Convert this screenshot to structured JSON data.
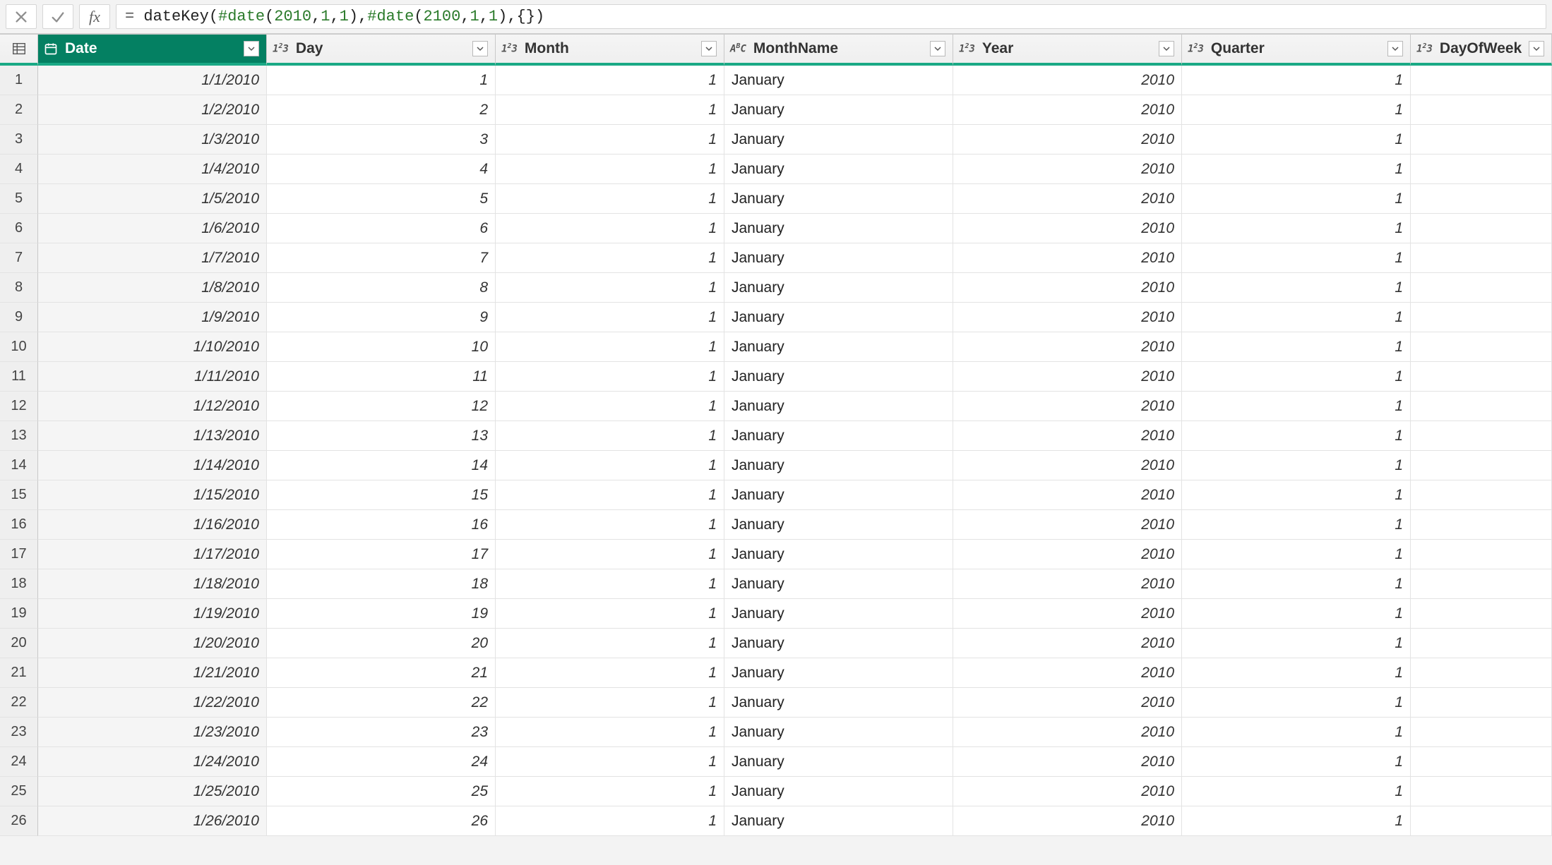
{
  "formula": {
    "raw": "= dateKey(#date(2010,1,1),#date(2100,1,1),{})",
    "tokens": [
      {
        "t": "eq",
        "v": "= "
      },
      {
        "t": "fn",
        "v": "dateKey"
      },
      {
        "t": "p",
        "v": "("
      },
      {
        "t": "kw",
        "v": "#date"
      },
      {
        "t": "p",
        "v": "("
      },
      {
        "t": "num",
        "v": "2010"
      },
      {
        "t": "c",
        "v": ","
      },
      {
        "t": "num",
        "v": "1"
      },
      {
        "t": "c",
        "v": ","
      },
      {
        "t": "num",
        "v": "1"
      },
      {
        "t": "p",
        "v": ")"
      },
      {
        "t": "c",
        "v": ","
      },
      {
        "t": "kw",
        "v": "#date"
      },
      {
        "t": "p",
        "v": "("
      },
      {
        "t": "num",
        "v": "2100"
      },
      {
        "t": "c",
        "v": ","
      },
      {
        "t": "num",
        "v": "1"
      },
      {
        "t": "c",
        "v": ","
      },
      {
        "t": "num",
        "v": "1"
      },
      {
        "t": "p",
        "v": ")"
      },
      {
        "t": "c",
        "v": ","
      },
      {
        "t": "p",
        "v": "{"
      },
      {
        "t": "p",
        "v": "}"
      },
      {
        "t": "p",
        "v": ")"
      }
    ]
  },
  "columns": [
    {
      "name": "Date",
      "type": "date",
      "align": "num",
      "selected": true
    },
    {
      "name": "Day",
      "type": "number",
      "align": "num",
      "selected": false
    },
    {
      "name": "Month",
      "type": "number",
      "align": "num",
      "selected": false
    },
    {
      "name": "MonthName",
      "type": "text",
      "align": "text",
      "selected": false
    },
    {
      "name": "Year",
      "type": "number",
      "align": "num",
      "selected": false
    },
    {
      "name": "Quarter",
      "type": "number",
      "align": "num",
      "selected": false
    },
    {
      "name": "DayOfWeek",
      "type": "number",
      "align": "num",
      "selected": false
    }
  ],
  "rows": [
    {
      "n": 1,
      "Date": "1/1/2010",
      "Day": "1",
      "Month": "1",
      "MonthName": "January",
      "Year": "2010",
      "Quarter": "1",
      "DayOfWeek": ""
    },
    {
      "n": 2,
      "Date": "1/2/2010",
      "Day": "2",
      "Month": "1",
      "MonthName": "January",
      "Year": "2010",
      "Quarter": "1",
      "DayOfWeek": ""
    },
    {
      "n": 3,
      "Date": "1/3/2010",
      "Day": "3",
      "Month": "1",
      "MonthName": "January",
      "Year": "2010",
      "Quarter": "1",
      "DayOfWeek": ""
    },
    {
      "n": 4,
      "Date": "1/4/2010",
      "Day": "4",
      "Month": "1",
      "MonthName": "January",
      "Year": "2010",
      "Quarter": "1",
      "DayOfWeek": ""
    },
    {
      "n": 5,
      "Date": "1/5/2010",
      "Day": "5",
      "Month": "1",
      "MonthName": "January",
      "Year": "2010",
      "Quarter": "1",
      "DayOfWeek": ""
    },
    {
      "n": 6,
      "Date": "1/6/2010",
      "Day": "6",
      "Month": "1",
      "MonthName": "January",
      "Year": "2010",
      "Quarter": "1",
      "DayOfWeek": ""
    },
    {
      "n": 7,
      "Date": "1/7/2010",
      "Day": "7",
      "Month": "1",
      "MonthName": "January",
      "Year": "2010",
      "Quarter": "1",
      "DayOfWeek": ""
    },
    {
      "n": 8,
      "Date": "1/8/2010",
      "Day": "8",
      "Month": "1",
      "MonthName": "January",
      "Year": "2010",
      "Quarter": "1",
      "DayOfWeek": ""
    },
    {
      "n": 9,
      "Date": "1/9/2010",
      "Day": "9",
      "Month": "1",
      "MonthName": "January",
      "Year": "2010",
      "Quarter": "1",
      "DayOfWeek": ""
    },
    {
      "n": 10,
      "Date": "1/10/2010",
      "Day": "10",
      "Month": "1",
      "MonthName": "January",
      "Year": "2010",
      "Quarter": "1",
      "DayOfWeek": ""
    },
    {
      "n": 11,
      "Date": "1/11/2010",
      "Day": "11",
      "Month": "1",
      "MonthName": "January",
      "Year": "2010",
      "Quarter": "1",
      "DayOfWeek": ""
    },
    {
      "n": 12,
      "Date": "1/12/2010",
      "Day": "12",
      "Month": "1",
      "MonthName": "January",
      "Year": "2010",
      "Quarter": "1",
      "DayOfWeek": ""
    },
    {
      "n": 13,
      "Date": "1/13/2010",
      "Day": "13",
      "Month": "1",
      "MonthName": "January",
      "Year": "2010",
      "Quarter": "1",
      "DayOfWeek": ""
    },
    {
      "n": 14,
      "Date": "1/14/2010",
      "Day": "14",
      "Month": "1",
      "MonthName": "January",
      "Year": "2010",
      "Quarter": "1",
      "DayOfWeek": ""
    },
    {
      "n": 15,
      "Date": "1/15/2010",
      "Day": "15",
      "Month": "1",
      "MonthName": "January",
      "Year": "2010",
      "Quarter": "1",
      "DayOfWeek": ""
    },
    {
      "n": 16,
      "Date": "1/16/2010",
      "Day": "16",
      "Month": "1",
      "MonthName": "January",
      "Year": "2010",
      "Quarter": "1",
      "DayOfWeek": ""
    },
    {
      "n": 17,
      "Date": "1/17/2010",
      "Day": "17",
      "Month": "1",
      "MonthName": "January",
      "Year": "2010",
      "Quarter": "1",
      "DayOfWeek": ""
    },
    {
      "n": 18,
      "Date": "1/18/2010",
      "Day": "18",
      "Month": "1",
      "MonthName": "January",
      "Year": "2010",
      "Quarter": "1",
      "DayOfWeek": ""
    },
    {
      "n": 19,
      "Date": "1/19/2010",
      "Day": "19",
      "Month": "1",
      "MonthName": "January",
      "Year": "2010",
      "Quarter": "1",
      "DayOfWeek": ""
    },
    {
      "n": 20,
      "Date": "1/20/2010",
      "Day": "20",
      "Month": "1",
      "MonthName": "January",
      "Year": "2010",
      "Quarter": "1",
      "DayOfWeek": ""
    },
    {
      "n": 21,
      "Date": "1/21/2010",
      "Day": "21",
      "Month": "1",
      "MonthName": "January",
      "Year": "2010",
      "Quarter": "1",
      "DayOfWeek": ""
    },
    {
      "n": 22,
      "Date": "1/22/2010",
      "Day": "22",
      "Month": "1",
      "MonthName": "January",
      "Year": "2010",
      "Quarter": "1",
      "DayOfWeek": ""
    },
    {
      "n": 23,
      "Date": "1/23/2010",
      "Day": "23",
      "Month": "1",
      "MonthName": "January",
      "Year": "2010",
      "Quarter": "1",
      "DayOfWeek": ""
    },
    {
      "n": 24,
      "Date": "1/24/2010",
      "Day": "24",
      "Month": "1",
      "MonthName": "January",
      "Year": "2010",
      "Quarter": "1",
      "DayOfWeek": ""
    },
    {
      "n": 25,
      "Date": "1/25/2010",
      "Day": "25",
      "Month": "1",
      "MonthName": "January",
      "Year": "2010",
      "Quarter": "1",
      "DayOfWeek": ""
    },
    {
      "n": 26,
      "Date": "1/26/2010",
      "Day": "26",
      "Month": "1",
      "MonthName": "January",
      "Year": "2010",
      "Quarter": "1",
      "DayOfWeek": ""
    }
  ]
}
